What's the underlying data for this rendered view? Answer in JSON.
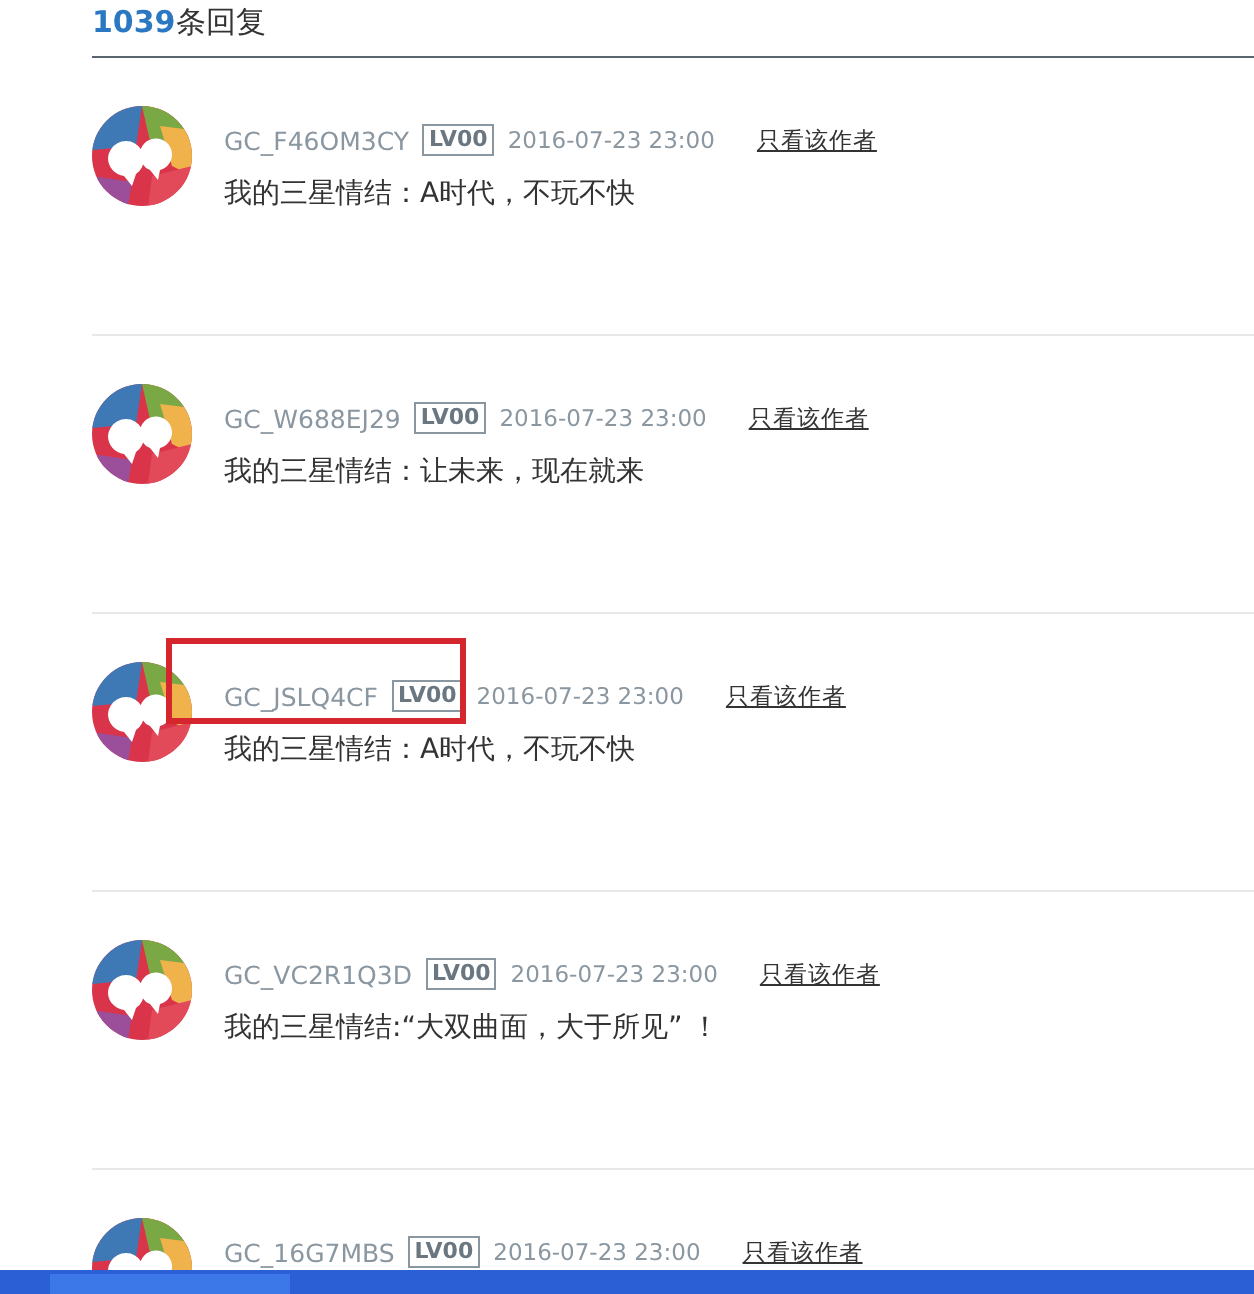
{
  "header": {
    "count": "1039",
    "label": "条回复"
  },
  "replies": [
    {
      "user": "GC_F46OM3CY",
      "level": "LV00",
      "date": "2016-07-23 23:00",
      "author_link": "只看该作者",
      "text": "我的三星情结：A时代，不玩不快",
      "highlighted": false
    },
    {
      "user": "GC_W688EJ29",
      "level": "LV00",
      "date": "2016-07-23 23:00",
      "author_link": "只看该作者",
      "text": "我的三星情结：让未来，现在就来",
      "highlighted": false
    },
    {
      "user": "GC_JSLQ4CF",
      "level": "LV00",
      "date": "2016-07-23 23:00",
      "author_link": "只看该作者",
      "text": "我的三星情结：A时代，不玩不快",
      "highlighted": true
    },
    {
      "user": "GC_VC2R1Q3D",
      "level": "LV00",
      "date": "2016-07-23 23:00",
      "author_link": "只看该作者",
      "text": "我的三星情结:“大双曲面，大于所见” ！",
      "highlighted": false
    },
    {
      "user": "GC_16G7MBS",
      "level": "LV00",
      "date": "2016-07-23 23:00",
      "author_link": "只看该作者",
      "highlighted": false
    }
  ]
}
